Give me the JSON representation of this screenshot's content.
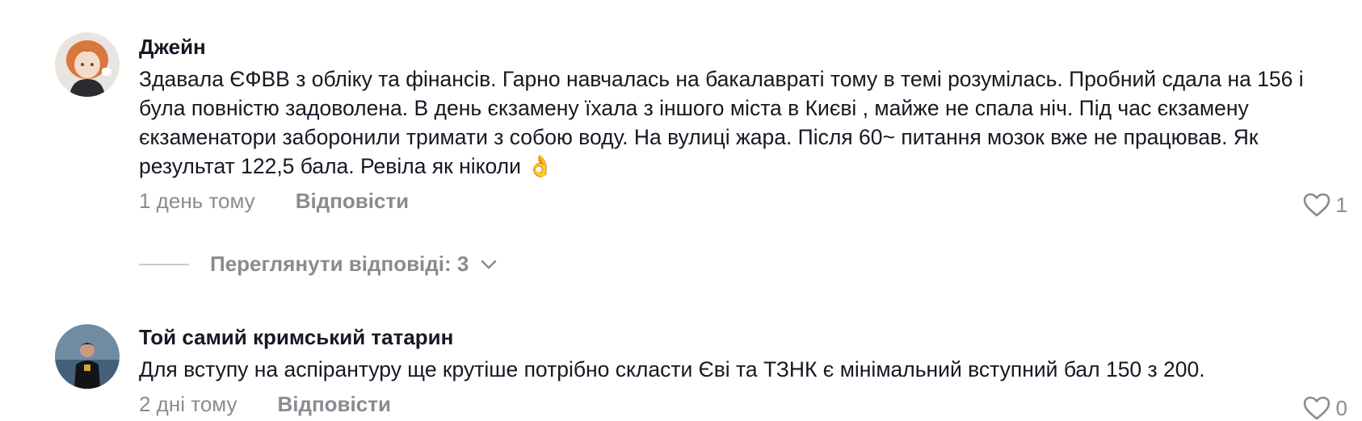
{
  "comments": [
    {
      "username": "Джейн",
      "text": "Здавала ЄФВВ з обліку та фінансів. Гарно навчалась на бакалавраті тому в темі розумілась. Пробний сдала на 156 і була повністю задоволена. В день єкзамену їхала з іншого міста в Києві , майже не спала ніч. Під час єкзамену єкзаменатори заборонили тримати з собою воду. На вулиці жара. Після 60~ питання мозок вже не працював. Як результат 122,5 бала. Ревіла як ніколи 👌",
      "time": "1 день тому",
      "reply_label": "Відповісти",
      "likes": "1",
      "view_replies": "Переглянути відповіді: 3",
      "avatar_icon": "anime-avatar-icon"
    },
    {
      "username": "Той самий кримський татарин",
      "text": "Для вступу на аспірантуру ще крутіше потрібно скласти Єві та ТЗНК є мінімальний вступний бал 150 з 200.",
      "time": "2 дні тому",
      "reply_label": "Відповісти",
      "likes": "0",
      "avatar_icon": "person-photo-avatar-icon"
    }
  ],
  "colors": {
    "primary_text": "#161823",
    "secondary_text": "#8a8b91",
    "divider": "#c8c9cc"
  }
}
